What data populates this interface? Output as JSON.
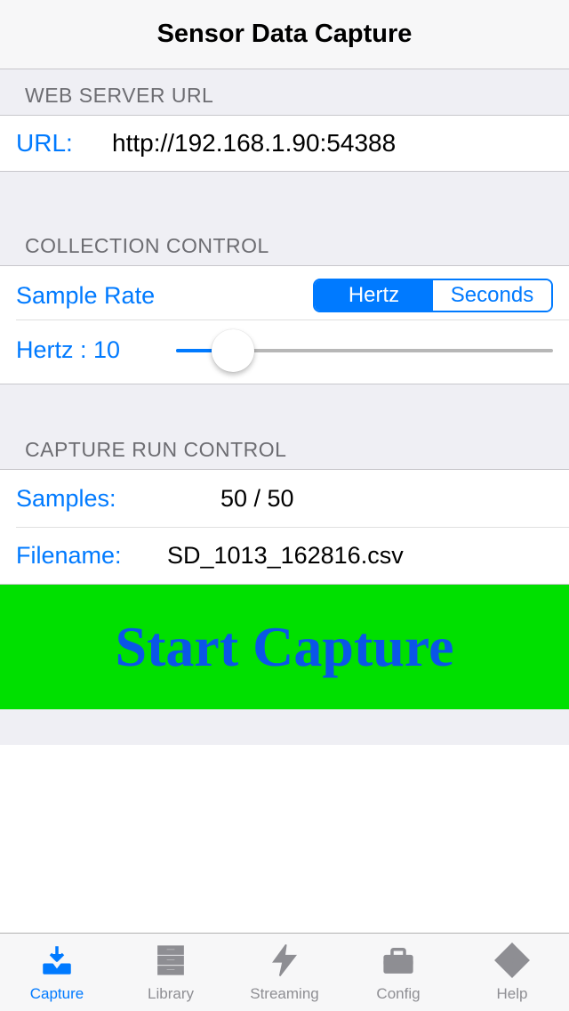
{
  "nav": {
    "title": "Sensor Data Capture"
  },
  "sections": {
    "web": {
      "header": "WEB SERVER URL"
    },
    "collection": {
      "header": "COLLECTION CONTROL"
    },
    "capture": {
      "header": "CAPTURE RUN CONTROL"
    }
  },
  "url": {
    "label": "URL:",
    "value": "http://192.168.1.90:54388"
  },
  "rate": {
    "label": "Sample Rate",
    "unit_hertz": "Hertz",
    "unit_seconds": "Seconds",
    "selected": "Hertz",
    "value_label": "Hertz  : 10",
    "slider_percent": 15
  },
  "samples": {
    "label": "Samples:",
    "value": "50 / 50"
  },
  "filename": {
    "label": "Filename:",
    "value": "SD_1013_162816.csv"
  },
  "start": {
    "label": "Start Capture"
  },
  "tabs": {
    "capture": "Capture",
    "library": "Library",
    "streaming": "Streaming",
    "config": "Config",
    "help": "Help"
  },
  "colors": {
    "accent": "#007aff",
    "startBg": "#00e000",
    "startFg": "#0a56e8"
  }
}
